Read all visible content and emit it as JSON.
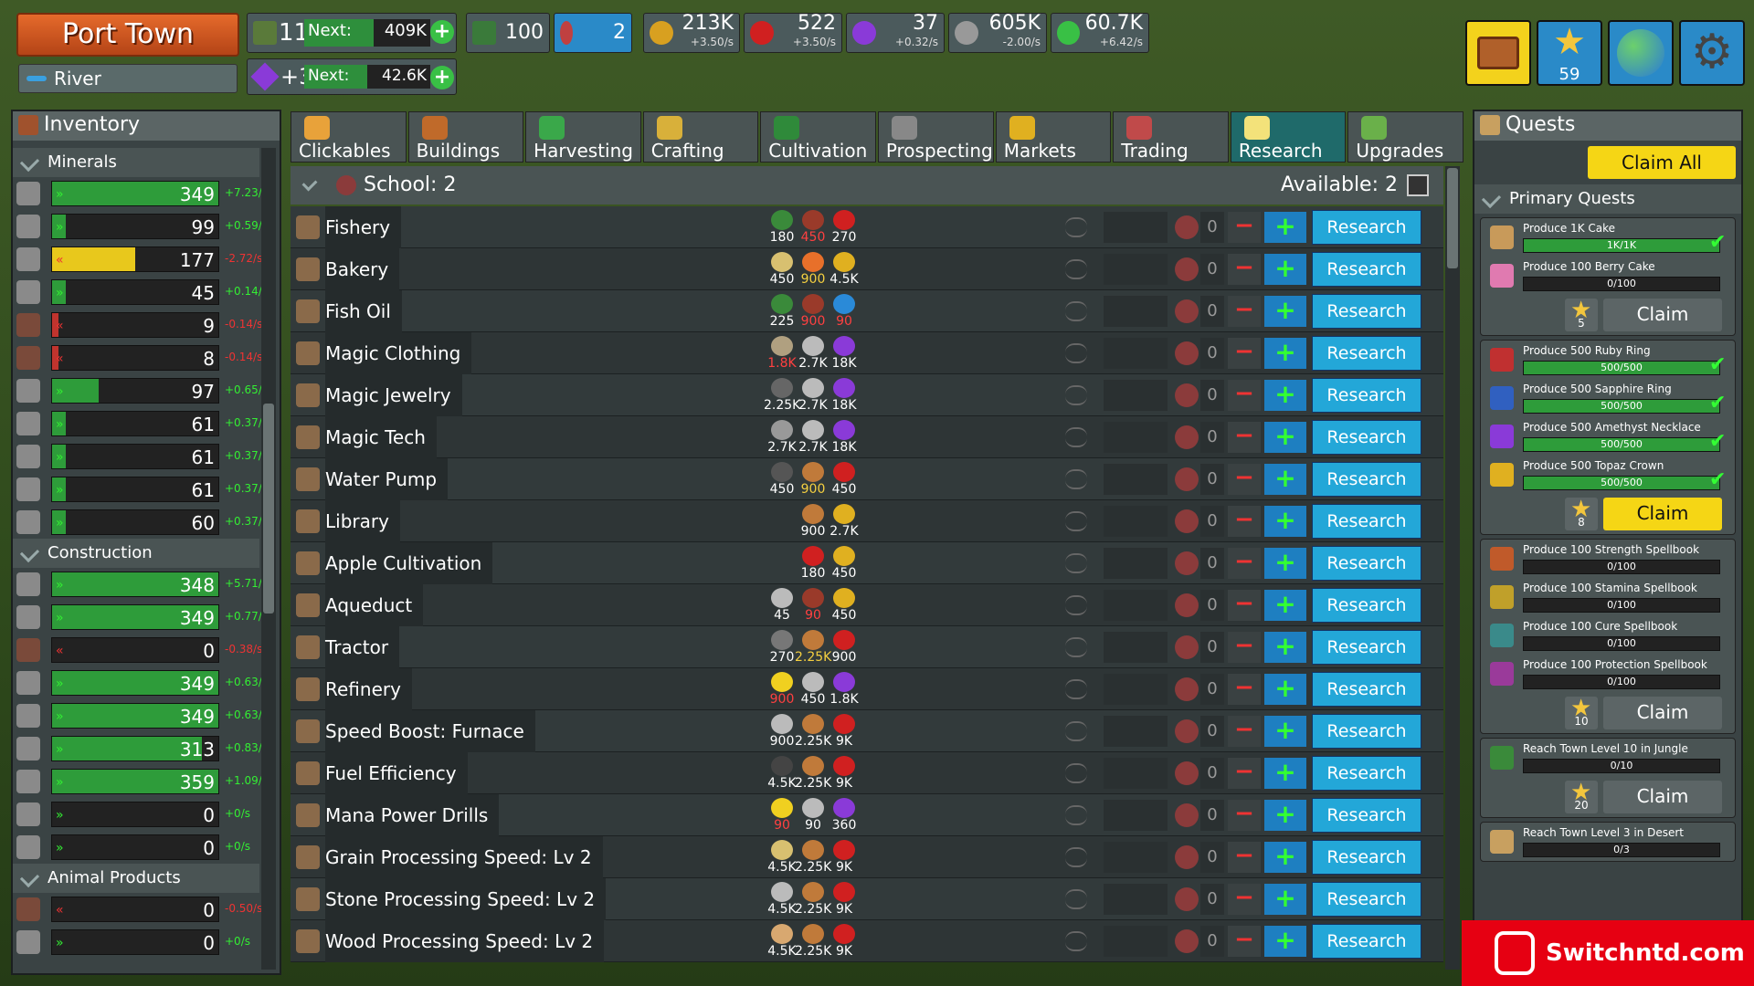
{
  "town": {
    "name": "Port Town",
    "biome": "River"
  },
  "level": {
    "value": "11",
    "next_label": "Next:",
    "next_value": "409K",
    "xp_fraction": 0.55
  },
  "prestige": {
    "value": "+3",
    "next_label": "Next:",
    "next_value": "42.6K",
    "xp_fraction": 0.5
  },
  "stats": [
    {
      "name": "land",
      "value": "100",
      "rate": ""
    },
    {
      "name": "workers",
      "value": "2",
      "rate": ""
    },
    {
      "name": "coins",
      "value": "213K",
      "rate": "+3.50/s"
    },
    {
      "name": "ruby",
      "value": "522",
      "rate": "+3.50/s"
    },
    {
      "name": "amethyst",
      "value": "37",
      "rate": "+0.32/s"
    },
    {
      "name": "silver",
      "value": "605K",
      "rate": "-2.00/s"
    },
    {
      "name": "xp",
      "value": "60.7K",
      "rate": "+6.42/s"
    }
  ],
  "top_buttons": {
    "stars": "59"
  },
  "inventory": {
    "title": "Inventory",
    "sections": [
      {
        "title": "Minerals",
        "items": [
          {
            "icon": "stone-icon",
            "value": "349",
            "rate": "+7.23/s",
            "fill": 1.0,
            "color": "#2e9c3a"
          },
          {
            "icon": "coal-icon",
            "value": "99",
            "rate": "+0.59/s",
            "fill": 0.08,
            "color": "#2e9c3a"
          },
          {
            "icon": "iron-ore-icon",
            "value": "177",
            "rate": "-2.72/s",
            "fill": 0.5,
            "color": "#e8c81c"
          },
          {
            "icon": "copper-ore-icon",
            "value": "45",
            "rate": "+0.14/s",
            "fill": 0.08,
            "color": "#2e9c3a"
          },
          {
            "icon": "dark-ore-icon",
            "value": "9",
            "rate": "-0.14/s",
            "fill": 0.04,
            "color": "#c0342e"
          },
          {
            "icon": "gold-ore-icon",
            "value": "8",
            "rate": "-0.14/s",
            "fill": 0.04,
            "color": "#c0342e"
          },
          {
            "icon": "quartz-icon",
            "value": "97",
            "rate": "+0.65/s",
            "fill": 0.28,
            "color": "#2e9c3a"
          },
          {
            "icon": "ruby-icon",
            "value": "61",
            "rate": "+0.37/s",
            "fill": 0.08,
            "color": "#2e9c3a"
          },
          {
            "icon": "topaz-icon",
            "value": "61",
            "rate": "+0.37/s",
            "fill": 0.08,
            "color": "#2e9c3a"
          },
          {
            "icon": "sapphire-icon",
            "value": "61",
            "rate": "+0.37/s",
            "fill": 0.08,
            "color": "#2e9c3a"
          },
          {
            "icon": "amethyst-icon",
            "value": "60",
            "rate": "+0.37/s",
            "fill": 0.08,
            "color": "#2e9c3a"
          }
        ]
      },
      {
        "title": "Construction",
        "items": [
          {
            "icon": "planks-icon",
            "value": "348",
            "rate": "+5.71/s",
            "fill": 1.0,
            "color": "#2e9c3a"
          },
          {
            "icon": "beam-icon",
            "value": "349",
            "rate": "+0.77/s",
            "fill": 1.0,
            "color": "#2e9c3a"
          },
          {
            "icon": "log-icon",
            "value": "0",
            "rate": "-0.38/s",
            "fill": 0.0,
            "color": "#c0342e"
          },
          {
            "icon": "brick-icon",
            "value": "349",
            "rate": "+0.63/s",
            "fill": 1.0,
            "color": "#2e9c3a"
          },
          {
            "icon": "steel-plate-icon",
            "value": "349",
            "rate": "+0.63/s",
            "fill": 1.0,
            "color": "#2e9c3a"
          },
          {
            "icon": "wheel-icon",
            "value": "313",
            "rate": "+0.83/s",
            "fill": 0.9,
            "color": "#2e9c3a"
          },
          {
            "icon": "nail-icon",
            "value": "359",
            "rate": "+1.09/s",
            "fill": 1.0,
            "color": "#2e9c3a"
          },
          {
            "icon": "hammer-icon",
            "value": "0",
            "rate": "+0/s",
            "fill": 0.0,
            "color": "#2e9c3a"
          },
          {
            "icon": "pickaxe-icon",
            "value": "0",
            "rate": "+0/s",
            "fill": 0.0,
            "color": "#2e9c3a"
          }
        ]
      },
      {
        "title": "Animal Products",
        "items": [
          {
            "icon": "leather-icon",
            "value": "0",
            "rate": "-0.50/s",
            "fill": 0.0,
            "color": "#c0342e"
          },
          {
            "icon": "egg-icon",
            "value": "0",
            "rate": "+0/s",
            "fill": 0.0,
            "color": "#2e9c3a"
          }
        ]
      }
    ]
  },
  "tabs": [
    {
      "label": "Clickables",
      "color": "#e8a23a"
    },
    {
      "label": "Buildings",
      "color": "#c06a2a"
    },
    {
      "label": "Harvesting",
      "color": "#3aa84a"
    },
    {
      "label": "Crafting",
      "color": "#d8b03a"
    },
    {
      "label": "Cultivation",
      "color": "#2f8a3a"
    },
    {
      "label": "Prospecting",
      "color": "#888"
    },
    {
      "label": "Markets",
      "color": "#e0b020"
    },
    {
      "label": "Trading",
      "color": "#c04a4a"
    },
    {
      "label": "Research",
      "color": "#f3e27a",
      "active": true
    },
    {
      "label": "Upgrades",
      "color": "#6ab04a"
    }
  ],
  "school": {
    "label": "School: 2",
    "available_label": "Available: 2"
  },
  "research_label": "Research",
  "research": [
    {
      "name": "Fishery",
      "icon": "fish-icon",
      "count": "0",
      "costs": [
        {
          "v": "180",
          "c": "#3a8a3a"
        },
        {
          "v": "450",
          "c": "#9a3a2a",
          "red": true
        },
        {
          "v": "270",
          "c": "#d02020"
        }
      ]
    },
    {
      "name": "Bakery",
      "icon": "bread-icon",
      "count": "0",
      "costs": [
        {
          "v": "450",
          "c": "#d8c070"
        },
        {
          "v": "900",
          "c": "#e8702a",
          "yel": true
        },
        {
          "v": "4.5K",
          "c": "#e0b020"
        }
      ]
    },
    {
      "name": "Fish Oil",
      "icon": "bottle-icon",
      "count": "0",
      "costs": [
        {
          "v": "225",
          "c": "#3a8a3a"
        },
        {
          "v": "900",
          "c": "#9a3a2a",
          "red": true
        },
        {
          "v": "90",
          "c": "#2a8ad8",
          "red": true
        }
      ]
    },
    {
      "name": "Magic Clothing",
      "icon": "robe-icon",
      "count": "0",
      "costs": [
        {
          "v": "1.8K",
          "c": "#b0a080",
          "red": true
        },
        {
          "v": "2.7K",
          "c": "#bbb"
        },
        {
          "v": "18K",
          "c": "#8a3ad8"
        }
      ]
    },
    {
      "name": "Magic Jewelry",
      "icon": "ring-icon",
      "count": "0",
      "costs": [
        {
          "v": "2.25K",
          "c": "#666"
        },
        {
          "v": "2.7K",
          "c": "#bbb"
        },
        {
          "v": "18K",
          "c": "#8a3ad8"
        }
      ]
    },
    {
      "name": "Magic Tech",
      "icon": "tech-icon",
      "count": "0",
      "costs": [
        {
          "v": "2.7K",
          "c": "#999"
        },
        {
          "v": "2.7K",
          "c": "#bbb"
        },
        {
          "v": "18K",
          "c": "#8a3ad8"
        }
      ]
    },
    {
      "name": "Water Pump",
      "icon": "pump-icon",
      "count": "0",
      "costs": [
        {
          "v": "450",
          "c": "#555"
        },
        {
          "v": "900",
          "c": "#c07a3a",
          "yel": true
        },
        {
          "v": "450",
          "c": "#d02020"
        }
      ]
    },
    {
      "name": "Library",
      "icon": "library-icon",
      "count": "0",
      "costs": [
        {
          "v": "900",
          "c": "#c07a3a"
        },
        {
          "v": "2.7K",
          "c": "#e0b020"
        }
      ]
    },
    {
      "name": "Apple Cultivation",
      "icon": "tree-icon",
      "count": "0",
      "costs": [
        {
          "v": "180",
          "c": "#d02020"
        },
        {
          "v": "450",
          "c": "#e0b020"
        }
      ]
    },
    {
      "name": "Aqueduct",
      "icon": "aqueduct-icon",
      "count": "0",
      "costs": [
        {
          "v": "45",
          "c": "#bbb"
        },
        {
          "v": "90",
          "c": "#9a3a2a",
          "red": true
        },
        {
          "v": "450",
          "c": "#e0b020"
        }
      ]
    },
    {
      "name": "Tractor",
      "icon": "tractor-icon",
      "count": "0",
      "costs": [
        {
          "v": "270",
          "c": "#777"
        },
        {
          "v": "2.25K",
          "c": "#c07a3a",
          "yel": true
        },
        {
          "v": "900",
          "c": "#d02020"
        }
      ]
    },
    {
      "name": "Refinery",
      "icon": "refinery-icon",
      "count": "0",
      "costs": [
        {
          "v": "900",
          "c": "#f0d020",
          "red": true
        },
        {
          "v": "450",
          "c": "#bbb"
        },
        {
          "v": "1.8K",
          "c": "#8a3ad8"
        }
      ]
    },
    {
      "name": "Speed Boost: Furnace",
      "icon": "furnace-icon",
      "count": "0",
      "costs": [
        {
          "v": "900",
          "c": "#bbb"
        },
        {
          "v": "2.25K",
          "c": "#c07a3a"
        },
        {
          "v": "9K",
          "c": "#d02020"
        }
      ]
    },
    {
      "name": "Fuel Efficiency",
      "icon": "flame-icon",
      "count": "0",
      "costs": [
        {
          "v": "4.5K",
          "c": "#444"
        },
        {
          "v": "2.25K",
          "c": "#c07a3a"
        },
        {
          "v": "9K",
          "c": "#d02020"
        }
      ]
    },
    {
      "name": "Mana Power Drills",
      "icon": "bolt-icon",
      "count": "0",
      "costs": [
        {
          "v": "90",
          "c": "#f0d020",
          "red": true
        },
        {
          "v": "90",
          "c": "#bbb"
        },
        {
          "v": "360",
          "c": "#8a3ad8"
        }
      ]
    },
    {
      "name": "Grain Processing Speed: Lv 2",
      "icon": "grain-icon",
      "count": "0",
      "costs": [
        {
          "v": "4.5K",
          "c": "#d8c070"
        },
        {
          "v": "2.25K",
          "c": "#c07a3a"
        },
        {
          "v": "9K",
          "c": "#d02020"
        }
      ]
    },
    {
      "name": "Stone Processing Speed: Lv 2",
      "icon": "stone-upgrade-icon",
      "count": "0",
      "costs": [
        {
          "v": "4.5K",
          "c": "#bbb"
        },
        {
          "v": "2.25K",
          "c": "#c07a3a"
        },
        {
          "v": "9K",
          "c": "#d02020"
        }
      ]
    },
    {
      "name": "Wood Processing Speed: Lv 2",
      "icon": "wood-upgrade-icon",
      "count": "0",
      "costs": [
        {
          "v": "4.5K",
          "c": "#d8a870"
        },
        {
          "v": "2.25K",
          "c": "#c07a3a"
        },
        {
          "v": "9K",
          "c": "#d02020"
        }
      ]
    }
  ],
  "quests": {
    "title": "Quests",
    "claim_all": "Claim All",
    "primary_title": "Primary Quests",
    "claim_label": "Claim",
    "groups": [
      {
        "stars": "5",
        "claim_active": false,
        "items": [
          {
            "title": "Produce 1K Cake",
            "progress": "1K/1K",
            "fill": 1.0,
            "done": true,
            "color": "#c89a5a"
          },
          {
            "title": "Produce 100 Berry Cake",
            "progress": "0/100",
            "fill": 0.0,
            "done": false,
            "color": "#e07ab0"
          }
        ]
      },
      {
        "stars": "8",
        "claim_active": true,
        "items": [
          {
            "title": "Produce 500 Ruby Ring",
            "progress": "500/500",
            "fill": 1.0,
            "done": true,
            "color": "#c03030"
          },
          {
            "title": "Produce 500 Sapphire Ring",
            "progress": "500/500",
            "fill": 1.0,
            "done": true,
            "color": "#3060c0"
          },
          {
            "title": "Produce 500 Amethyst Necklace",
            "progress": "500/500",
            "fill": 1.0,
            "done": true,
            "color": "#8a3ad8"
          },
          {
            "title": "Produce 500 Topaz Crown",
            "progress": "500/500",
            "fill": 1.0,
            "done": true,
            "color": "#e0b020"
          }
        ]
      },
      {
        "stars": "10",
        "claim_active": false,
        "items": [
          {
            "title": "Produce 100 Strength Spellbook",
            "progress": "0/100",
            "fill": 0.0,
            "done": false,
            "color": "#c05a2a"
          },
          {
            "title": "Produce 100 Stamina Spellbook",
            "progress": "0/100",
            "fill": 0.0,
            "done": false,
            "color": "#c0a02a"
          },
          {
            "title": "Produce 100 Cure Spellbook",
            "progress": "0/100",
            "fill": 0.0,
            "done": false,
            "color": "#3a8a8a"
          },
          {
            "title": "Produce 100 Protection Spellbook",
            "progress": "0/100",
            "fill": 0.0,
            "done": false,
            "color": "#9a3a9a"
          }
        ]
      },
      {
        "stars": "20",
        "claim_active": false,
        "items": [
          {
            "title": "Reach Town Level 10 in Jungle",
            "progress": "0/10",
            "fill": 0.0,
            "done": false,
            "color": "#3a8a3a"
          }
        ]
      }
    ],
    "partial": {
      "title": "Reach Town Level 3 in Desert",
      "progress": "0/3"
    }
  },
  "watermark": "Switchntd.com"
}
